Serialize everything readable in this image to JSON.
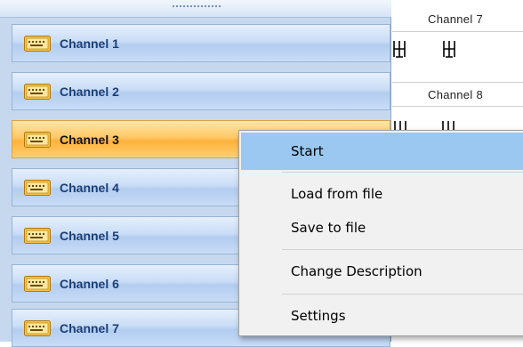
{
  "nav": {
    "buttons": [
      {
        "label": "Channel 1",
        "active": false
      },
      {
        "label": "Channel 2",
        "active": false
      },
      {
        "label": "Channel 3",
        "active": true
      },
      {
        "label": "Channel 4",
        "active": false
      },
      {
        "label": "Channel 5",
        "active": false
      },
      {
        "label": "Channel 6",
        "active": false
      },
      {
        "label": "Channel 7",
        "active": false
      }
    ],
    "icon": "keyboard-icon",
    "colors": {
      "panel_blue": "#c6d8ee",
      "active_orange": "#ffb23a",
      "label_blue": "#1a3f78"
    }
  },
  "strip": {
    "headers": [
      "Channel 7",
      "Channel 8"
    ]
  },
  "context_menu": {
    "items": {
      "start": "Start",
      "load": "Load from file",
      "save": "Save to file",
      "change_description": "Change Description",
      "settings": "Settings"
    },
    "highlighted": "Start",
    "highlight_color": "#9ac8f0"
  }
}
